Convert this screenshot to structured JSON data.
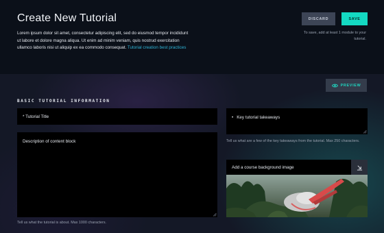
{
  "header": {
    "title": "Create New Tutorial",
    "intro_text": "Lorem ipsum dolor sit amet, consectetur adipiscing elit, sed do eiusmod tempor incididunt ut labore et dolore magna aliqua. Ut enim ad minim veniam, quis nostrud exercitation ullamco laboris nisi ut aliquip ex ea commodo consequat.",
    "intro_link": "Tutorial creation best practices",
    "discard_label": "DISCARD",
    "save_label": "SAVE",
    "save_note": "To save, add at least 1 module to your tutorial."
  },
  "main": {
    "preview_label": "PREVIEW",
    "section_title": "BASIC TUTORIAL INFORMATION",
    "title_field": "* Tutorial Title",
    "description_field": "Description of content block",
    "description_help": "Tell us what the tutorial is about.  Max 1000 characters.",
    "takeaways_field": "Key tutorial takeaways",
    "takeaways_help": "Tell us what are a few of the key takeaways from the tutorial.  Max 250 characters.",
    "background_label": "Add a course background image"
  },
  "colors": {
    "accent": "#14d9c2",
    "link": "#2fb5d8",
    "header_bg": "#0b1019",
    "field_bg": "#000000"
  },
  "icons": {
    "preview": "eye-icon",
    "upload": "upload-icon",
    "bullet": "bullet-icon"
  }
}
